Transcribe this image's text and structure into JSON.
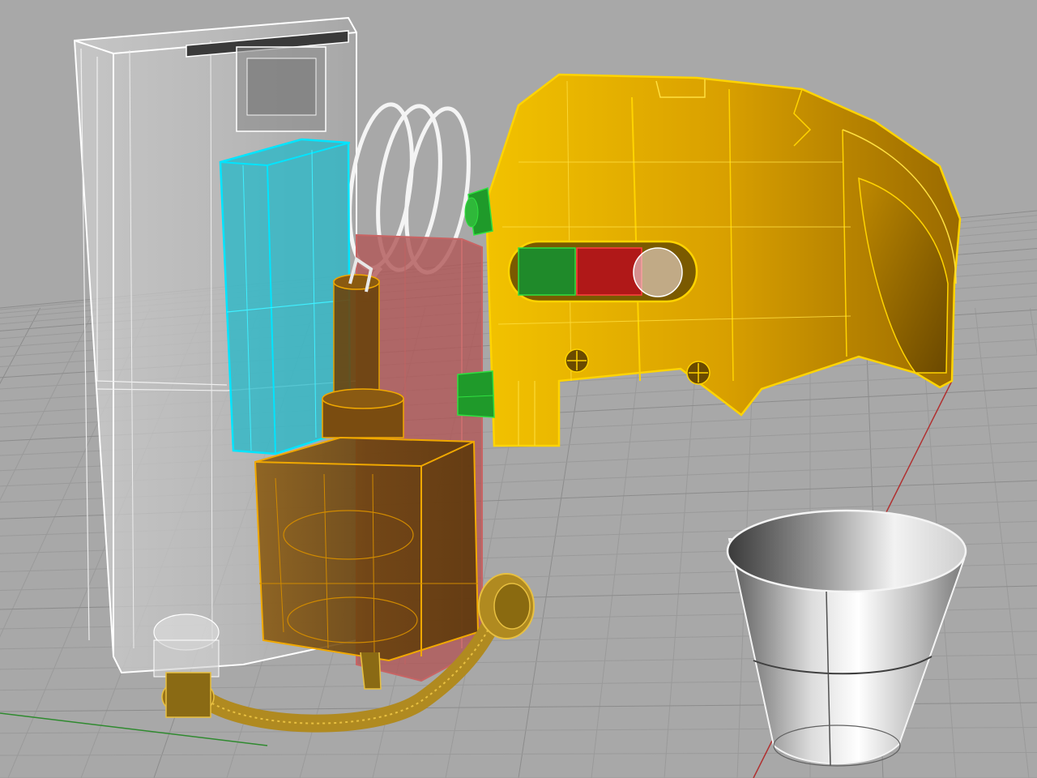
{
  "viewport": {
    "projection": "perspective",
    "display_mode": "ghosted-wireframe",
    "background_color": "#a8a8a8",
    "grid": {
      "visible": true,
      "line_color": "#9a9a9a",
      "major_line_color": "#8c8c8c",
      "x_axis_color": "#b03030",
      "y_axis_color": "#2f8a2f"
    }
  },
  "objects": [
    {
      "name": "water-tank",
      "color": "#d8d8d8",
      "edge_color": "#ffffff",
      "selected": false
    },
    {
      "name": "control-board",
      "color": "#30d0e0",
      "edge_color": "#00e5ff",
      "selected": true
    },
    {
      "name": "heating-coil",
      "color": "#d0d0d0",
      "edge_color": "#f0f0f0",
      "selected": false
    },
    {
      "name": "boiler-block",
      "color": "#c46a6a",
      "edge_color": "#c86464",
      "selected": false
    },
    {
      "name": "pump-assembly",
      "color": "#7a4a10",
      "edge_color": "#f0a800",
      "selected": true
    },
    {
      "name": "brew-head-housing",
      "color": "#e0a800",
      "edge_color": "#ffd400",
      "selected": true
    },
    {
      "name": "valve-bracket",
      "color": "#1f9a2a",
      "edge_color": "#30e040",
      "selected": false
    },
    {
      "name": "outlet-hose",
      "color": "#b08a20",
      "edge_color": "#e8c040",
      "selected": true
    },
    {
      "name": "drip-cup",
      "color": "#c8c8c8",
      "edge_color": "#f4f4f4",
      "selected": false
    }
  ]
}
